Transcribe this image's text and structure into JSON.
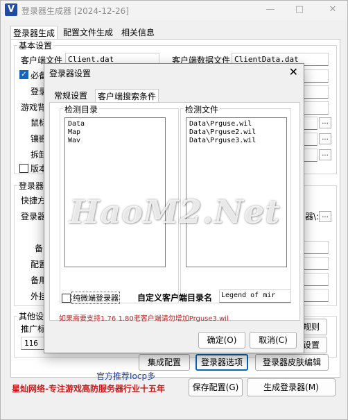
{
  "window": {
    "title": "登录器生成器 [2024-12-26]",
    "icon_letter": "V",
    "controls": [
      "—",
      "□",
      "✕"
    ]
  },
  "main_tabs": [
    "登录器生成",
    "配置文件生成",
    "相关信息"
  ],
  "basic": {
    "group_label": "基本设置",
    "client_file_label": "客户端文件",
    "client_file_value": "Client.dat",
    "client_data_label": "客户端数据文件",
    "client_data_value": "ClientData.dat",
    "required_label": "必备",
    "partial_labels": [
      "登录",
      "游戏背",
      "鼠标",
      "镶嵌",
      "拆卸"
    ],
    "version_label": "版本",
    "dots": "..."
  },
  "launcher": {
    "group_label": "登录器",
    "shortcut_label": "快捷方",
    "launcher_label": "登录器",
    "path_tail": "器\\:",
    "partial_labels": [
      "备",
      "配置",
      "备用",
      "外挂"
    ]
  },
  "other": {
    "group_label": "其他设",
    "promo_label": "推广标",
    "promo_value": "116",
    "rules_btn": "规则",
    "settings_btn": "设置"
  },
  "bottom": {
    "integrate_btn": "集成配置",
    "options_btn": "登录器选项",
    "skin_btn": "登录器皮肤编辑",
    "recommend": "官方推荐Iocp多",
    "company": "星灿网络-专注游戏高防服务器行业十五年",
    "save_btn": "保存配置(G)",
    "generate_btn": "生成登录器(M)"
  },
  "dialog": {
    "title": "登录器设置",
    "tabs": [
      "常规设置",
      "客户端搜索条件"
    ],
    "dir_label": "检测目录",
    "dirs": [
      "Data",
      "Map",
      "Wav"
    ],
    "file_label": "检测文件",
    "files": [
      "Data\\Prguse.wil",
      "Data\\Prguse2.wil",
      "Data\\Prguse3.wil"
    ],
    "pure_label": "纯微端登录器",
    "custom_dir_label": "自定义客户端目录名",
    "custom_dir_value": "Legend of mir",
    "note": "如果需要支持1.76 1.80老客户端请勿增加Prguse3.wil",
    "ok_btn": "确定(O)",
    "cancel_btn": "取消(C)"
  },
  "watermark": "HaoM2.Net"
}
